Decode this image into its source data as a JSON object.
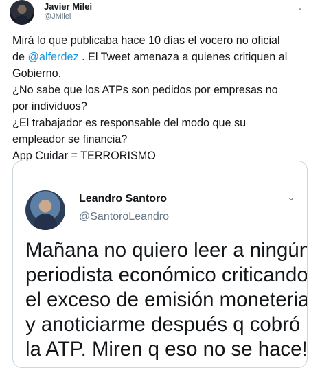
{
  "tweet": {
    "author": {
      "name": "Javier Milei",
      "handle": "@JMilei"
    },
    "menu_icon": "chevron-down-icon",
    "body": {
      "line1": "Mirá lo que publicaba hace 10 días el vocero no oficial",
      "line2_prefix": "de ",
      "line2_mention": "@alferdez",
      "line2_suffix": " . El Tweet amenaza a quienes critiquen al",
      "line3": "Gobierno.",
      "line4": "¿No sabe que los ATPs son pedidos por empresas no",
      "line5": "por individuos?",
      "line6": "¿El trabajador es responsable del modo que su",
      "line7": "empleador se financia?",
      "line8": "App Cuidar = TERRORISMO"
    },
    "quoted": {
      "author": {
        "name": "Leandro Santoro",
        "handle": "@SantoroLeandro"
      },
      "menu_icon": "chevron-down-icon",
      "lines": [
        "Mañana no quiero leer a ningún",
        "periodista económico criticando",
        "el exceso de emisión moneteria",
        "y anoticiarme después q cobró",
        "la ATP. Miren q eso no se hace!"
      ]
    }
  },
  "colors": {
    "text": "#14171a",
    "secondary": "#657786",
    "link": "#1b95e0",
    "border": "#ccd6dd"
  }
}
